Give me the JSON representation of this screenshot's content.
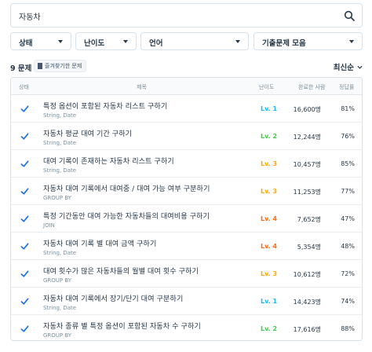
{
  "search": {
    "value": "자동차",
    "icon": "search-icon"
  },
  "filters": [
    {
      "label": "상태",
      "name": "filter-status"
    },
    {
      "label": "난이도",
      "name": "filter-level"
    },
    {
      "label": "언어",
      "name": "filter-language"
    },
    {
      "label": "기출문제 모음",
      "name": "filter-collection"
    }
  ],
  "summary": {
    "count": "9 문제",
    "bookmark_label": "즐겨찾기한 문제"
  },
  "sort": {
    "label": "최신순"
  },
  "table": {
    "headers": {
      "status": "상태",
      "title": "제목",
      "level": "난이도",
      "solved": "완료한 사람",
      "rate": "정답률"
    },
    "rows": [
      {
        "title": "특정 옵션이 포함된 자동차 리스트 구하기",
        "tags": "String, Date",
        "level": "Lv. 1",
        "solved": "16,600명",
        "rate": "81%"
      },
      {
        "title": "자동차 평균 대여 기간 구하기",
        "tags": "String, Date",
        "level": "Lv. 2",
        "solved": "12,244명",
        "rate": "76%"
      },
      {
        "title": "대여 기록이 존재하는 자동차 리스트 구하기",
        "tags": "String, Date",
        "level": "Lv. 3",
        "solved": "10,457명",
        "rate": "85%"
      },
      {
        "title": "자동차 대여 기록에서 대여중 / 대여 가능 여부 구분하기",
        "tags": "GROUP BY",
        "level": "Lv. 3",
        "solved": "11,253명",
        "rate": "77%"
      },
      {
        "title": "특정 기간동안 대여 가능한 자동차들의 대여비용 구하기",
        "tags": "JOIN",
        "level": "Lv. 4",
        "solved": "7,652명",
        "rate": "47%"
      },
      {
        "title": "자동차 대여 기록 별 대여 금액 구하기",
        "tags": "String, Date",
        "level": "Lv. 4",
        "solved": "5,354명",
        "rate": "48%"
      },
      {
        "title": "대여 횟수가 많은 자동차들의 월별 대여 횟수 구하기",
        "tags": "GROUP BY",
        "level": "Lv. 3",
        "solved": "10,612명",
        "rate": "72%"
      },
      {
        "title": "자동차 대여 기록에서 장기/단기 대여 구분하기",
        "tags": "String, Date",
        "level": "Lv. 1",
        "solved": "14,423명",
        "rate": "74%"
      },
      {
        "title": "자동차 종류 별 특정 옵션이 포함된 자동차 수 구하기",
        "tags": "GROUP BY",
        "level": "Lv. 2",
        "solved": "17,616명",
        "rate": "88%"
      }
    ]
  },
  "colors": {
    "check": "#1a73e8",
    "level_1": "#1bbaff",
    "level_2": "#47c84c",
    "level_3": "#ffa800",
    "level_4": "#ff6b18"
  }
}
